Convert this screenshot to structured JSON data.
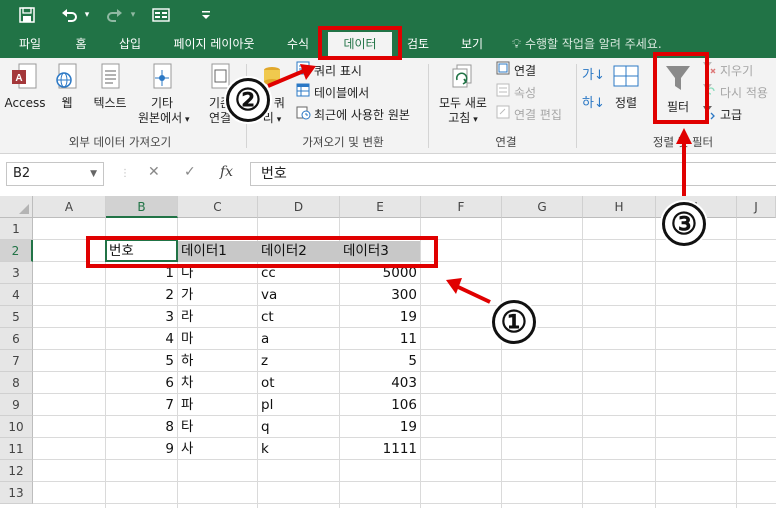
{
  "title_bar": {
    "save_icon": "save-icon",
    "undo_icon": "undo-icon",
    "redo_icon": "redo-icon",
    "form_icon": "form-icon",
    "customize_icon": "customize-qat-icon"
  },
  "tabs": [
    {
      "label": "파일"
    },
    {
      "label": "홈"
    },
    {
      "label": "삽입"
    },
    {
      "label": "페이지 레이아웃"
    },
    {
      "label": "수식"
    },
    {
      "label": "데이터",
      "active": true
    },
    {
      "label": "검토"
    },
    {
      "label": "보기"
    }
  ],
  "tell_me": "수행할 작업을 알려 주세요.",
  "ribbon": {
    "external": {
      "access": "Access",
      "web": "웹",
      "text": "텍스트",
      "other_line1": "기타",
      "other_line2": "원본에서",
      "existing_line1": "기존",
      "existing_line2": "연결",
      "group_label": "외부 데이터 가져오기"
    },
    "get_transform": {
      "new_query_line1": "새 쿼",
      "new_query_line2": "리",
      "show_queries": "쿼리 표시",
      "from_table": "테이블에서",
      "recent_sources": "최근에 사용한 원본",
      "group_label": "가져오기 및 변환"
    },
    "connections": {
      "refresh_line1": "모두 새로",
      "refresh_line2": "고침",
      "connections": "연결",
      "properties": "속성",
      "edit_links": "연결 편집",
      "group_label": "연결"
    },
    "sort_filter": {
      "sort_az": "가↓",
      "sort_za": "하↓",
      "sort": "정렬",
      "filter": "필터",
      "clear": "지우기",
      "reapply": "다시 적용",
      "advanced": "고급",
      "group_label": "정렬 및 필터"
    }
  },
  "formula_bar": {
    "name_box": "B2",
    "cancel": "✕",
    "enter": "✓",
    "fx": "fx",
    "value": "번호"
  },
  "grid": {
    "columns": [
      "A",
      "B",
      "C",
      "D",
      "E",
      "F",
      "G",
      "H",
      "I",
      "J"
    ],
    "rows": [
      "1",
      "2",
      "3",
      "4",
      "5",
      "6",
      "7",
      "8",
      "9",
      "10",
      "11",
      "12",
      "13"
    ],
    "headers": [
      "번호",
      "데이터1",
      "데이터2",
      "데이터3"
    ],
    "data": [
      [
        "1",
        "다",
        "cc",
        "5000"
      ],
      [
        "2",
        "가",
        "va",
        "300"
      ],
      [
        "3",
        "라",
        "ct",
        "19"
      ],
      [
        "4",
        "마",
        "a",
        "11"
      ],
      [
        "5",
        "하",
        "z",
        "5"
      ],
      [
        "6",
        "차",
        "ot",
        "403"
      ],
      [
        "7",
        "파",
        "pl",
        "106"
      ],
      [
        "8",
        "타",
        "q",
        "19"
      ],
      [
        "9",
        "사",
        "k",
        "1111"
      ]
    ]
  },
  "annotations": {
    "one": "①",
    "two": "②",
    "three": "③",
    "accent_color": "#e00000",
    "excel_green": "#217346"
  }
}
